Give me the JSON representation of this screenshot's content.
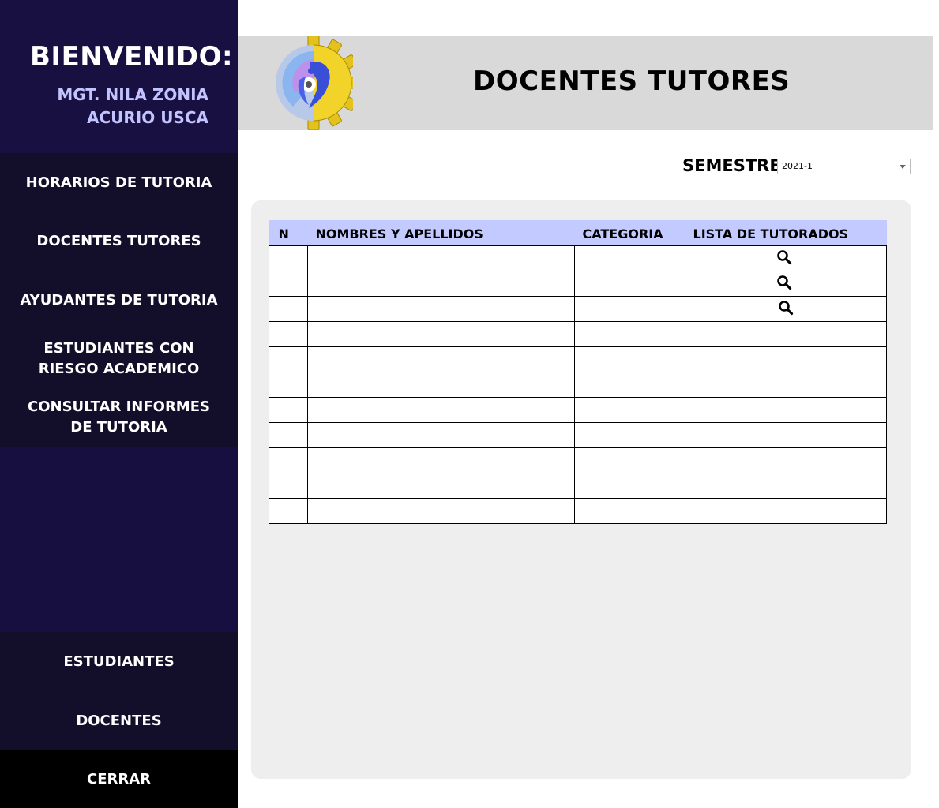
{
  "sidebar": {
    "welcome_title": "BIENVENIDO:",
    "user_name_line1": "MGT. NILA ZONIA",
    "user_name_line2": "ACURIO USCA",
    "menu": [
      {
        "label": "HORARIOS DE TUTORIA"
      },
      {
        "label": "DOCENTES TUTORES"
      },
      {
        "label": "AYUDANTES DE TUTORIA"
      },
      {
        "label": "ESTUDIANTES CON RIESGO ACADEMICO"
      },
      {
        "label": "CONSULTAR INFORMES DE TUTORIA"
      }
    ],
    "bottom_menu": [
      {
        "label": "ESTUDIANTES"
      },
      {
        "label": "DOCENTES"
      }
    ],
    "close_label": "CERRAR"
  },
  "header": {
    "title": "DOCENTES TUTORES",
    "logo_icon": "gear-cd-logo"
  },
  "semester": {
    "label": "SEMESTRE:",
    "selected": "2021-1"
  },
  "table": {
    "headers": [
      "N",
      "NOMBRES Y APELLIDOS",
      "CATEGORIA",
      "LISTA DE TUTORADOS"
    ],
    "row_count": 11,
    "rows_with_search_icon": 3,
    "header_color": "#c2caff"
  },
  "colors": {
    "sidebar_bg": "#160f3f",
    "menu_bg": "#130f2b",
    "header_bg": "#d9d9d9",
    "user_name": "#c3c3ff"
  }
}
